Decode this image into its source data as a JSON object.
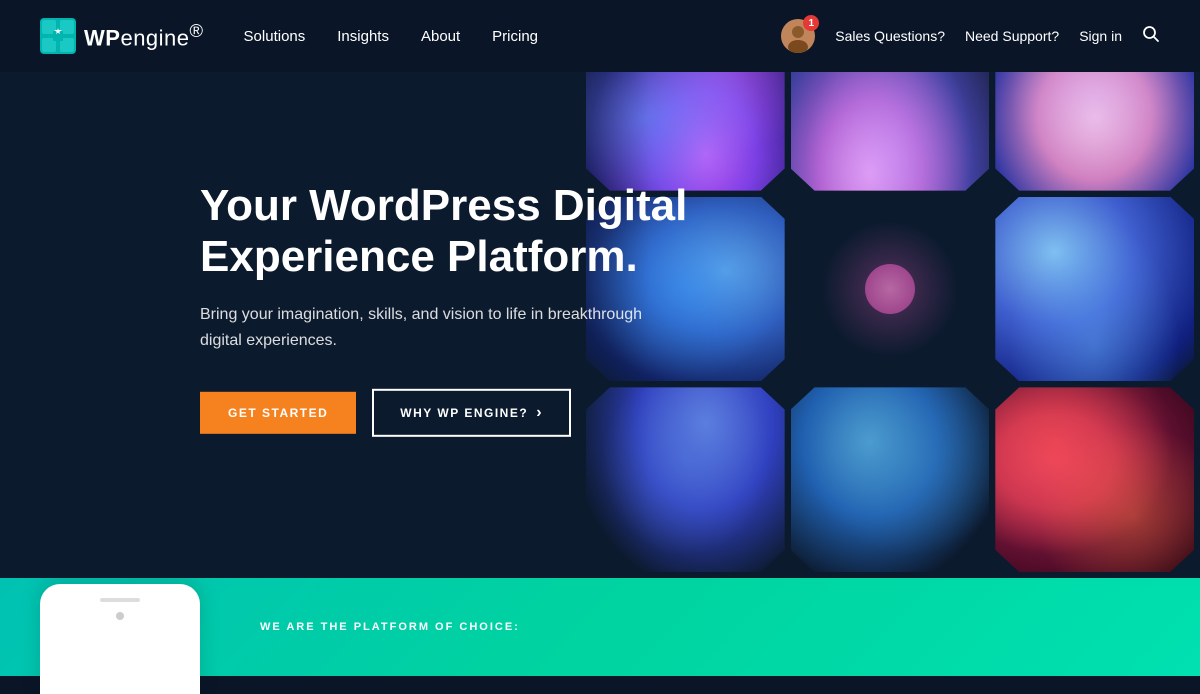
{
  "navbar": {
    "logo_text_bold": "WP",
    "logo_text_light": "engine",
    "logo_trademark": "®",
    "nav_links": [
      {
        "id": "solutions",
        "label": "Solutions"
      },
      {
        "id": "insights",
        "label": "Insights"
      },
      {
        "id": "about",
        "label": "About"
      },
      {
        "id": "pricing",
        "label": "Pricing"
      }
    ],
    "sales_questions": "Sales Questions?",
    "need_support": "Need Support?",
    "sign_in": "Sign in",
    "avatar_badge": "1"
  },
  "hero": {
    "title": "Your WordPress Digital Experience Platform.",
    "subtitle": "Bring your imagination, skills, and vision to life in breakthrough digital experiences.",
    "btn_primary": "GET STARTED",
    "btn_secondary": "WHY WP ENGINE?",
    "btn_arrow": "›"
  },
  "bottom": {
    "platform_label": "WE ARE THE PLATFORM OF CHOICE:"
  },
  "colors": {
    "bg_dark": "#0c1a2e",
    "orange": "#f5821f",
    "teal": "#00c2b3",
    "nav_bg": "#0a1628"
  }
}
